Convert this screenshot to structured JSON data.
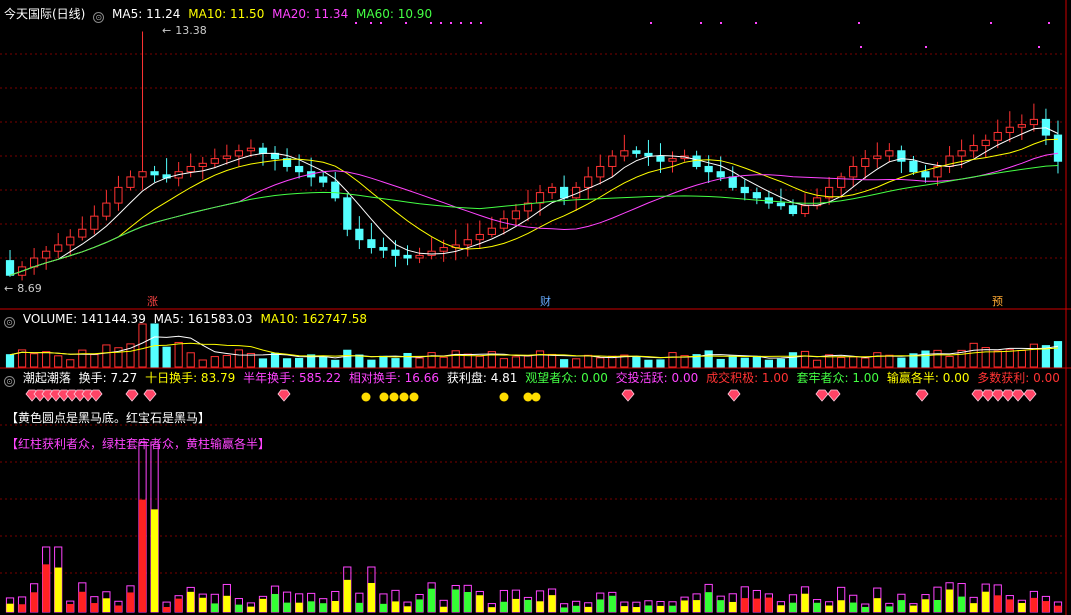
{
  "panel_main": {
    "title": "今天国际(日线)",
    "ma5": "MA5: 11.24",
    "ma10": "MA10: 11.50",
    "ma20": "MA20: 11.34",
    "ma60": "MA60: 10.90",
    "high_label": "13.38",
    "low_label": "8.69",
    "event_tags": [
      {
        "text": "涨",
        "color": "#ff4444"
      },
      {
        "text": "财",
        "color": "#66aaff"
      },
      {
        "text": "预",
        "color": "#ffaa33"
      }
    ]
  },
  "panel_volume": {
    "title": "VOLUME: 141144.39",
    "ma5": "MA5: 161583.03",
    "ma10": "MA10: 162747.58"
  },
  "panel_indicator": {
    "title": "潮起潮落",
    "metrics": [
      {
        "text": "换手: 7.27",
        "color": "#ffffff"
      },
      {
        "text": "十日换手: 83.79",
        "color": "#ffff00"
      },
      {
        "text": "半年换手: 585.22",
        "color": "#ff44ff"
      },
      {
        "text": "相对换手: 16.66",
        "color": "#ff44ff"
      },
      {
        "text": "获利盘: 4.81",
        "color": "#ffffff"
      },
      {
        "text": "观望者众: 0.00",
        "color": "#44ff44"
      },
      {
        "text": "交投活跃: 0.00",
        "color": "#ff44ff"
      },
      {
        "text": "成交积极: 1.00",
        "color": "#ff3333"
      },
      {
        "text": "套牢者众: 1.00",
        "color": "#44ff44"
      },
      {
        "text": "输赢各半: 0.00",
        "color": "#ffff00"
      },
      {
        "text": "多数获利: 0.00",
        "color": "#ff3333"
      }
    ],
    "note1": "【黄色圆点是黑马底。红宝石是黑马】",
    "note2": "【红柱获利者众，绿柱套牢者众，黄柱输赢各半】"
  },
  "colors": {
    "up": "#ff3333",
    "down": "#54ffff",
    "ma5": "#ffffff",
    "ma10": "#ffff00",
    "ma20": "#ff44ff",
    "ma60": "#44ff44",
    "grid": "#7a0000"
  },
  "chart_data": {
    "type": "candlestick",
    "n_bars": 88,
    "price_range": [
      8.4,
      13.6
    ],
    "open": [
      9.0,
      8.72,
      8.88,
      9.05,
      9.18,
      9.3,
      9.45,
      9.6,
      9.85,
      10.1,
      10.4,
      10.6,
      10.7,
      10.64,
      10.58,
      10.7,
      10.8,
      10.86,
      10.95,
      11.0,
      11.1,
      11.15,
      11.05,
      10.95,
      10.8,
      10.7,
      10.6,
      10.5,
      10.2,
      9.6,
      9.4,
      9.25,
      9.2,
      9.1,
      9.05,
      9.1,
      9.18,
      9.25,
      9.3,
      9.4,
      9.5,
      9.62,
      9.8,
      9.95,
      10.1,
      10.3,
      10.4,
      10.2,
      10.4,
      10.6,
      10.8,
      11.0,
      11.1,
      11.05,
      11.0,
      10.9,
      10.95,
      11.0,
      10.8,
      10.7,
      10.6,
      10.4,
      10.3,
      10.2,
      10.1,
      10.05,
      9.9,
      10.05,
      10.2,
      10.4,
      10.6,
      10.8,
      10.95,
      11.0,
      11.1,
      10.9,
      10.7,
      10.6,
      10.8,
      11.0,
      11.1,
      11.2,
      11.3,
      11.45,
      11.55,
      11.6,
      11.7,
      11.4
    ],
    "close": [
      8.72,
      8.88,
      9.05,
      9.18,
      9.3,
      9.45,
      9.6,
      9.85,
      10.1,
      10.4,
      10.6,
      10.7,
      10.64,
      10.58,
      10.7,
      10.8,
      10.86,
      10.95,
      11.0,
      11.1,
      11.15,
      11.05,
      10.95,
      10.8,
      10.7,
      10.6,
      10.5,
      10.2,
      9.6,
      9.4,
      9.25,
      9.2,
      9.1,
      9.05,
      9.1,
      9.18,
      9.25,
      9.3,
      9.4,
      9.5,
      9.62,
      9.8,
      9.95,
      10.1,
      10.3,
      10.4,
      10.2,
      10.4,
      10.6,
      10.8,
      11.0,
      11.1,
      11.05,
      11.0,
      10.9,
      10.95,
      11.0,
      10.8,
      10.7,
      10.6,
      10.4,
      10.3,
      10.2,
      10.1,
      10.05,
      9.9,
      10.05,
      10.2,
      10.4,
      10.6,
      10.8,
      10.95,
      11.0,
      11.1,
      10.9,
      10.7,
      10.6,
      10.8,
      11.0,
      11.1,
      11.2,
      11.3,
      11.45,
      11.55,
      11.6,
      11.7,
      11.4,
      10.9
    ],
    "volume_range": [
      0,
      600000
    ],
    "indicator_range": [
      0,
      100
    ]
  }
}
